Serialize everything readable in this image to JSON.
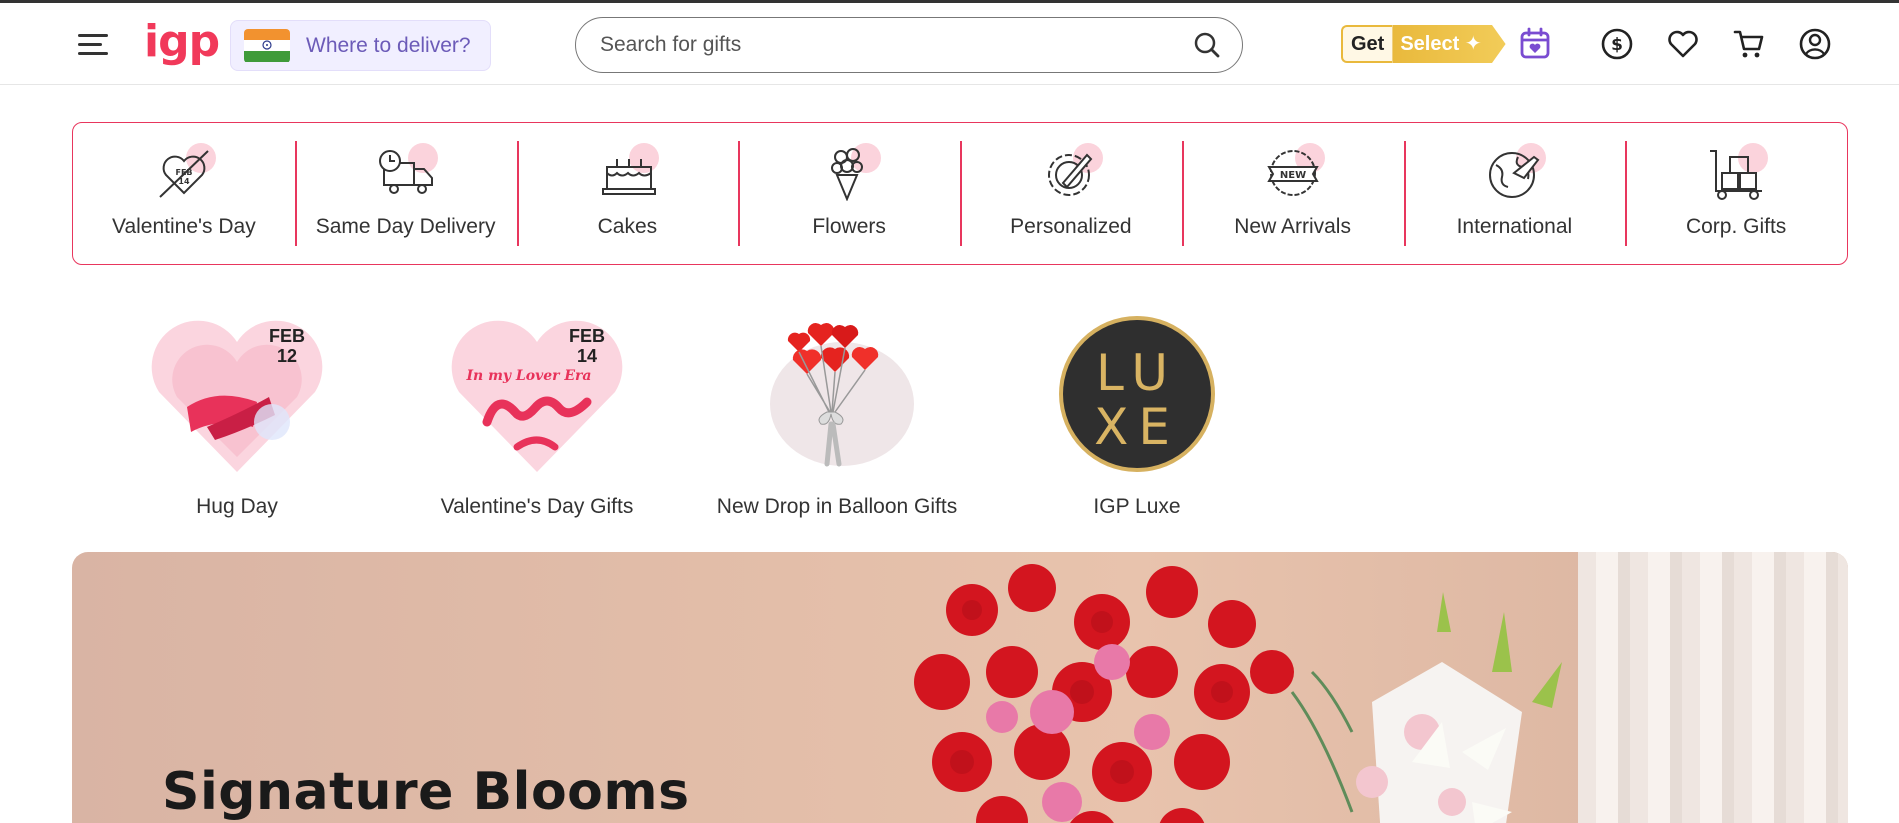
{
  "header": {
    "logo_text": "igp",
    "deliver_label": "Where to deliver?",
    "search_placeholder": "Search for gifts",
    "get_label": "Get",
    "select_label": "Select ✦",
    "colors": {
      "brand": "#f1395a",
      "deliver_text": "#6c5bb8",
      "select_gold": "#e9b93c"
    },
    "icons": [
      "hamburger-menu-icon",
      "india-flag-icon",
      "search-icon",
      "calendar-heart-icon",
      "currency-icon",
      "wishlist-heart-icon",
      "cart-icon",
      "account-icon"
    ]
  },
  "categories": [
    {
      "label": "Valentine's Day",
      "icon": "valentine-heart-icon"
    },
    {
      "label": "Same Day Delivery",
      "icon": "delivery-truck-icon"
    },
    {
      "label": "Cakes",
      "icon": "cake-icon"
    },
    {
      "label": "Flowers",
      "icon": "flower-bouquet-icon"
    },
    {
      "label": "Personalized",
      "icon": "personalized-gear-icon"
    },
    {
      "label": "New Arrivals",
      "icon": "new-badge-icon"
    },
    {
      "label": "International",
      "icon": "globe-plane-icon"
    },
    {
      "label": "Corp. Gifts",
      "icon": "corporate-trolley-icon"
    }
  ],
  "tiles": [
    {
      "label": "Hug Day",
      "badge_month": "FEB",
      "badge_day": "12"
    },
    {
      "label": "Valentine's Day Gifts",
      "badge_month": "FEB",
      "badge_day": "14",
      "art_text": "In my Lover Era"
    },
    {
      "label": "New Drop in Balloon Gifts"
    },
    {
      "label": "IGP Luxe",
      "art_text_top": "LU",
      "art_text_bottom": "XE"
    }
  ],
  "banner": {
    "title": "Signature Blooms"
  }
}
